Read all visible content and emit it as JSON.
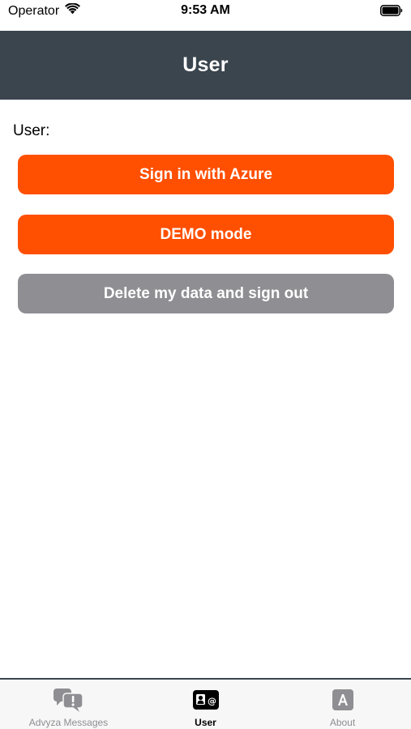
{
  "status_bar": {
    "carrier": "Operator",
    "time": "9:53 AM",
    "icons": [
      "wifi-icon",
      "battery-icon"
    ]
  },
  "nav": {
    "title": "User"
  },
  "content": {
    "user_label": "User:",
    "buttons": {
      "sign_in_azure": "Sign in with Azure",
      "demo_mode": "DEMO mode",
      "delete_sign_out": "Delete my data and sign out"
    }
  },
  "tab_bar": {
    "tabs": [
      {
        "label": "Advyza Messages",
        "icon": "messages-alert-icon",
        "active": false
      },
      {
        "label": "User",
        "icon": "contact-card-icon",
        "active": true
      },
      {
        "label": "About",
        "icon": "letter-a-icon",
        "active": false
      }
    ]
  },
  "colors": {
    "nav_background": "#3a454e",
    "primary_button": "#ff4f00",
    "secondary_button": "#8e8e93",
    "tab_inactive": "#8e8e93",
    "tab_active": "#000000"
  }
}
